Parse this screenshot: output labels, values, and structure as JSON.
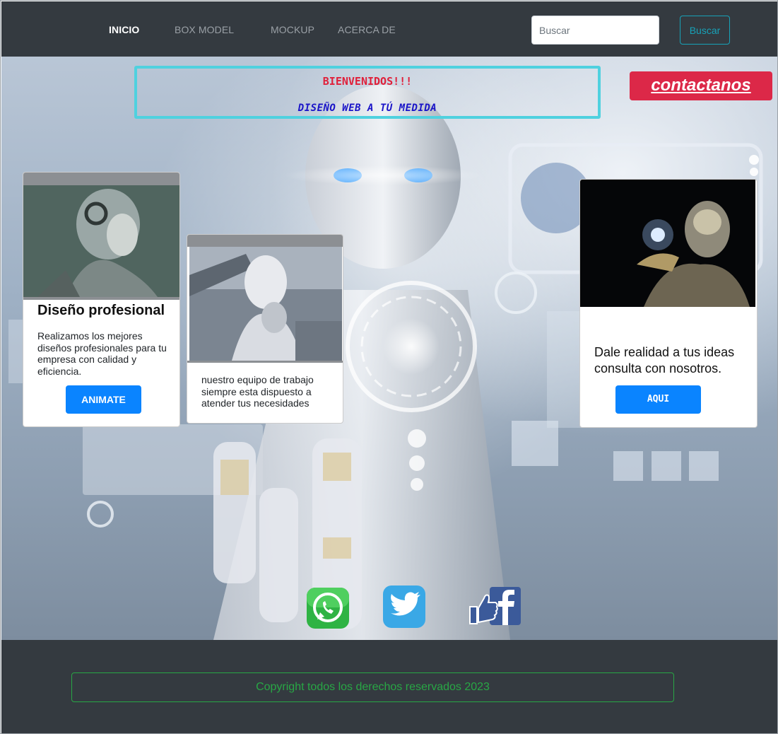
{
  "nav": {
    "links": [
      {
        "label": "INICIO",
        "active": true
      },
      {
        "label": "BOX MODEL",
        "active": false
      },
      {
        "label": "MOCKUP",
        "active": false
      },
      {
        "label": "ACERCA DE",
        "active": false
      }
    ],
    "search": {
      "placeholder": "Buscar",
      "value": ""
    },
    "search_button_label": "Buscar"
  },
  "hero": {
    "welcome_title": "BIENVENIDOS!!!",
    "welcome_subtitle": "DISEÑO WEB A TÚ MEDIDA",
    "contact_label": "contactanos"
  },
  "cards": [
    {
      "title": "Diseño profesional",
      "text": "Realizamos los mejores diseños profesionales para tu empresa con calidad y eficiencia.",
      "button_label": "ANIMATE"
    },
    {
      "text": "nuestro equipo de trabajo siempre esta dispuesto a atender tus necesidades"
    },
    {
      "text": "Dale realidad a tus ideas consulta con nosotros.",
      "button_label": "AQUI"
    }
  ],
  "social": [
    "whatsapp-icon",
    "twitter-icon",
    "facebook-icon"
  ],
  "footer": {
    "copyright": "Copyright todos los derechos reservados 2023"
  },
  "colors": {
    "navbar_bg": "#343a40",
    "accent_teal": "#17a2b8",
    "contact_red": "#dc2848",
    "primary_blue": "#0a84ff",
    "footer_green": "#28a745",
    "welcome_border": "#4fd1df"
  }
}
